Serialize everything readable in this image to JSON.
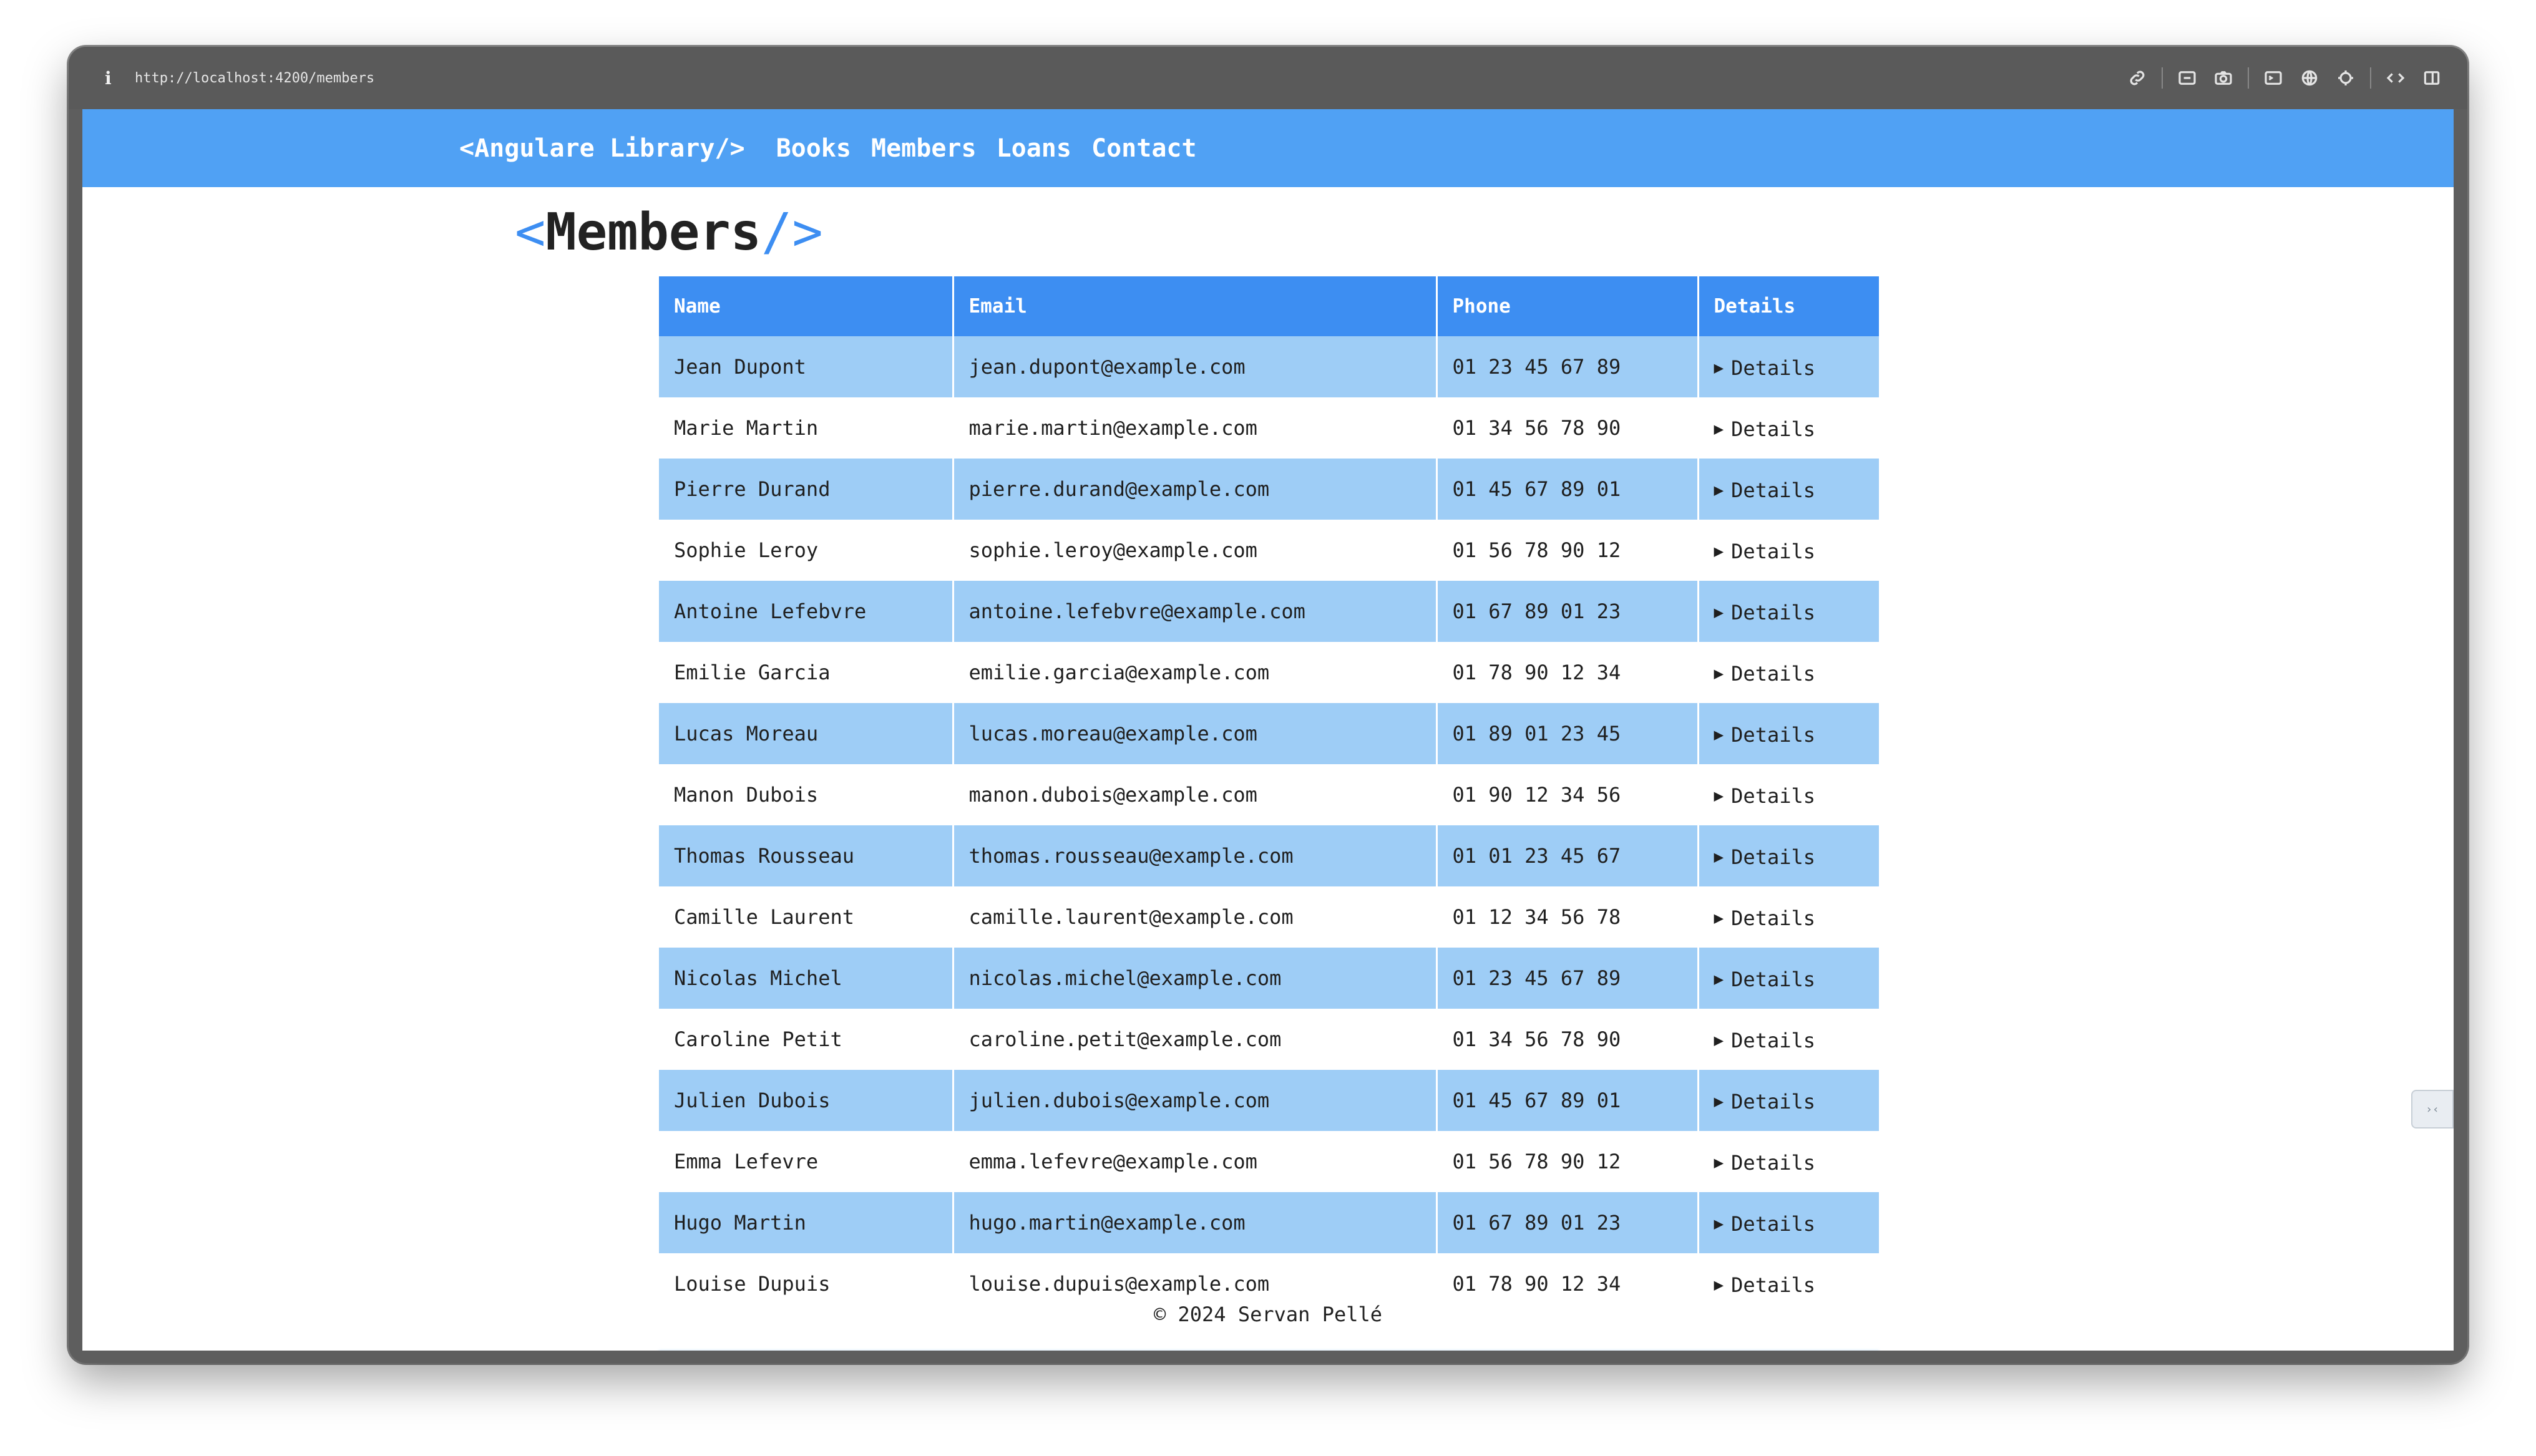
{
  "browser": {
    "url": "http://localhost:4200/members",
    "info_icon": "i"
  },
  "nav": {
    "brand": "<Angulare Library/>",
    "links": [
      "Books",
      "Members",
      "Loans",
      "Contact"
    ]
  },
  "page": {
    "title_open": "<",
    "title_text": "Members",
    "title_close": "/>"
  },
  "table": {
    "headers": [
      "Name",
      "Email",
      "Phone",
      "Details"
    ],
    "details_label": "Details",
    "rows": [
      {
        "name": "Jean Dupont",
        "email": "jean.dupont@example.com",
        "phone": "01 23 45 67 89"
      },
      {
        "name": "Marie Martin",
        "email": "marie.martin@example.com",
        "phone": "01 34 56 78 90"
      },
      {
        "name": "Pierre Durand",
        "email": "pierre.durand@example.com",
        "phone": "01 45 67 89 01"
      },
      {
        "name": "Sophie Leroy",
        "email": "sophie.leroy@example.com",
        "phone": "01 56 78 90 12"
      },
      {
        "name": "Antoine Lefebvre",
        "email": "antoine.lefebvre@example.com",
        "phone": "01 67 89 01 23"
      },
      {
        "name": "Emilie Garcia",
        "email": "emilie.garcia@example.com",
        "phone": "01 78 90 12 34"
      },
      {
        "name": "Lucas Moreau",
        "email": "lucas.moreau@example.com",
        "phone": "01 89 01 23 45"
      },
      {
        "name": "Manon Dubois",
        "email": "manon.dubois@example.com",
        "phone": "01 90 12 34 56"
      },
      {
        "name": "Thomas Rousseau",
        "email": "thomas.rousseau@example.com",
        "phone": "01 01 23 45 67"
      },
      {
        "name": "Camille Laurent",
        "email": "camille.laurent@example.com",
        "phone": "01 12 34 56 78"
      },
      {
        "name": "Nicolas Michel",
        "email": "nicolas.michel@example.com",
        "phone": "01 23 45 67 89"
      },
      {
        "name": "Caroline Petit",
        "email": "caroline.petit@example.com",
        "phone": "01 34 56 78 90"
      },
      {
        "name": "Julien Dubois",
        "email": "julien.dubois@example.com",
        "phone": "01 45 67 89 01"
      },
      {
        "name": "Emma Lefevre",
        "email": "emma.lefevre@example.com",
        "phone": "01 56 78 90 12"
      },
      {
        "name": "Hugo Martin",
        "email": "hugo.martin@example.com",
        "phone": "01 67 89 01 23"
      },
      {
        "name": "Louise Dupuis",
        "email": "louise.dupuis@example.com",
        "phone": "01 78 90 12 34"
      }
    ]
  },
  "footer": {
    "text": "© 2024 Servan Pellé"
  },
  "colors": {
    "navbar": "#50a1f4",
    "header": "#3d8ef2",
    "row_alt": "#9ecdf6"
  },
  "icons": {
    "toolbar": [
      "link-icon",
      "screenshot-icon",
      "camera-icon",
      "terminal-icon",
      "globe-icon",
      "crosshair-icon",
      "code-icon",
      "sidebar-icon"
    ]
  }
}
